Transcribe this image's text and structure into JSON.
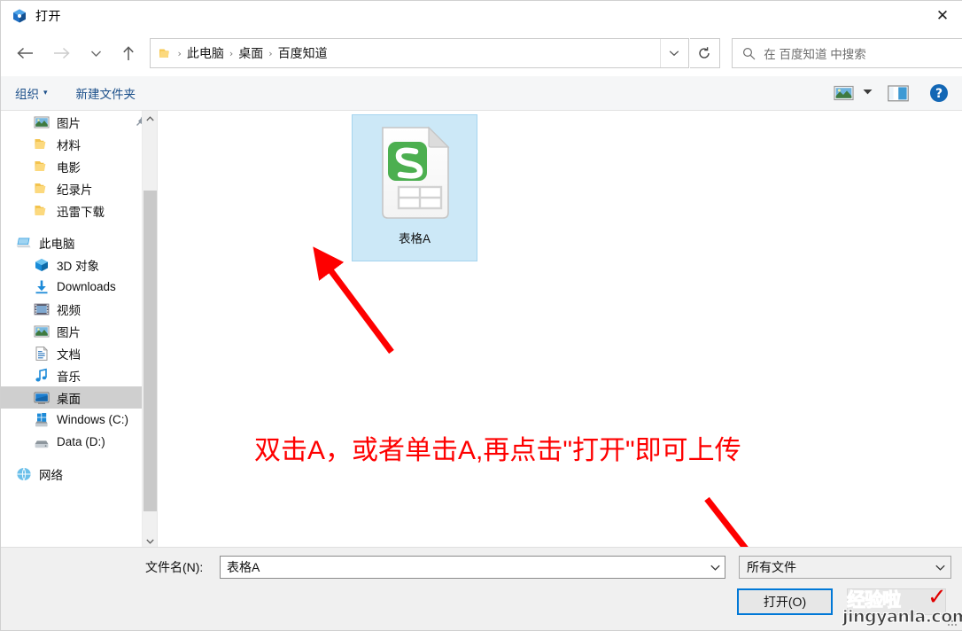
{
  "window": {
    "title": "打开",
    "title_icon": "open-dialog-icon",
    "close_label": "✕"
  },
  "nav": {
    "back_icon": "arrow-left-icon",
    "forward_icon": "arrow-right-icon",
    "history_icon": "chevron-down-icon",
    "up_icon": "arrow-up-icon",
    "refresh_icon": "refresh-icon",
    "address_chevron": "chevron-down-icon",
    "breadcrumb": [
      "此电脑",
      "桌面",
      "百度知道"
    ],
    "separator": "›"
  },
  "search": {
    "placeholder": "在 百度知道 中搜索",
    "icon": "search-icon"
  },
  "toolbar": {
    "organize_label": "组织",
    "organize_caret": "▾",
    "new_folder_label": "新建文件夹",
    "view_icon": "view-options-icon",
    "view_caret": "▼",
    "pane_icon": "preview-pane-icon",
    "help_icon": "help-icon",
    "help_label": "?"
  },
  "sidebar": {
    "items": [
      {
        "label": "图片",
        "icon": "pictures-icon",
        "pinned": true,
        "selected": false,
        "root": false
      },
      {
        "label": "材料",
        "icon": "folder-icon",
        "pinned": false,
        "selected": false,
        "root": false
      },
      {
        "label": "电影",
        "icon": "folder-icon",
        "pinned": false,
        "selected": false,
        "root": false
      },
      {
        "label": "纪录片",
        "icon": "folder-icon",
        "pinned": false,
        "selected": false,
        "root": false
      },
      {
        "label": "迅雷下载",
        "icon": "folder-icon",
        "pinned": false,
        "selected": false,
        "root": false
      },
      {
        "label": "此电脑",
        "icon": "this-pc-icon",
        "pinned": false,
        "selected": false,
        "root": true
      },
      {
        "label": "3D 对象",
        "icon": "3d-objects-icon",
        "pinned": false,
        "selected": false,
        "root": false
      },
      {
        "label": "Downloads",
        "icon": "downloads-icon",
        "pinned": false,
        "selected": false,
        "root": false
      },
      {
        "label": "视频",
        "icon": "videos-icon",
        "pinned": false,
        "selected": false,
        "root": false
      },
      {
        "label": "图片",
        "icon": "pictures-icon",
        "pinned": false,
        "selected": false,
        "root": false
      },
      {
        "label": "文档",
        "icon": "documents-icon",
        "pinned": false,
        "selected": false,
        "root": false
      },
      {
        "label": "音乐",
        "icon": "music-icon",
        "pinned": false,
        "selected": false,
        "root": false
      },
      {
        "label": "桌面",
        "icon": "desktop-icon",
        "pinned": false,
        "selected": true,
        "root": false
      },
      {
        "label": "Windows (C:)",
        "icon": "windows-drive-icon",
        "pinned": false,
        "selected": false,
        "root": false
      },
      {
        "label": "Data (D:)",
        "icon": "drive-icon",
        "pinned": false,
        "selected": false,
        "root": false
      },
      {
        "label": "网络",
        "icon": "network-icon",
        "pinned": false,
        "selected": false,
        "root": true
      }
    ],
    "scroll_up_icon": "chevron-up-icon",
    "scroll_down_icon": "chevron-down-icon"
  },
  "files": [
    {
      "name": "表格A",
      "icon": "wps-spreadsheet-icon",
      "selected": true
    }
  ],
  "annotation": {
    "text": "双击A，或者单击A,再点击\"打开\"即可上传",
    "color": "#fe0000"
  },
  "footer": {
    "filename_label": "文件名(N):",
    "filename_value": "表格A",
    "filetype_value": "所有文件",
    "filetype_chevron": "⌄",
    "filename_chevron": "⌄",
    "open_button_label": "打开(O)"
  },
  "watermark": {
    "cn": "经验啦",
    "check": "✓",
    "domain": "jingyanla.com"
  },
  "colors": {
    "accent": "#0078d7",
    "selection_fill": "#cce8f7",
    "selection_border": "#a5d4ef",
    "annotation_red": "#fe0000",
    "command_link": "#1b4f8a"
  }
}
